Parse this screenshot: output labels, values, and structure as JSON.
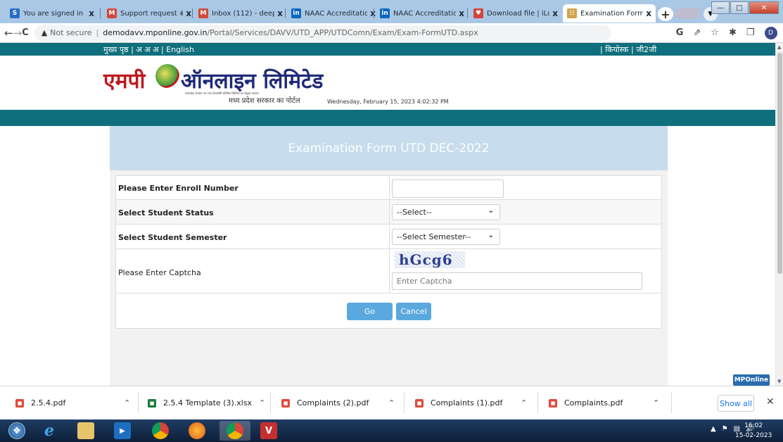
{
  "browser": {
    "tabs": [
      {
        "label": "You are signed in",
        "favicon": "S",
        "color": "#2a6dc4"
      },
      {
        "label": "Support request #",
        "favicon": "M",
        "color": "#d24a3a"
      },
      {
        "label": "Inbox (112) - deep",
        "favicon": "M",
        "color": "#d24a3a"
      },
      {
        "label": "NAAC Accreditatio",
        "favicon": "in",
        "color": "#0a66c2"
      },
      {
        "label": "NAAC Accreditatio",
        "favicon": "in",
        "color": "#0a66c2"
      },
      {
        "label": "Download file | iLo",
        "favicon": "♥",
        "color": "#d5423a"
      },
      {
        "label": "Examination Form",
        "favicon": "☷",
        "color": "#d2a24a"
      }
    ],
    "new_tab": "+",
    "tab_close": "x",
    "url": {
      "warning": "▲",
      "not_secure": "Not secure",
      "host": "demodavv.mponline.gov.in",
      "path": "/Portal/Services/DAVV/UTD_APP/UTDComn/Exam/Exam-FormUTD.aspx"
    },
    "nav": {
      "back": "←",
      "forward": "→",
      "reload": "C"
    },
    "toolbar_icons": {
      "google": "G",
      "share": "⇗",
      "star": "☆",
      "extensions": "✱",
      "sidepanel": "❒",
      "profile": "D",
      "menu": "⋮"
    }
  },
  "page": {
    "top_nav_left": "मुख्य पृष्ठ | अ  अ  अ  | English",
    "top_nav_right": "| कियोस्क | जी2जी",
    "logo": {
      "left": "एमपी",
      "right": "ऑनलाइन लिमिटेड",
      "tagline": "मध्यप्रदेश सरकार एवं टाटा कंसल्टेंसी सर्विसेस लिमिटेड का संयुक्त उपक्रम",
      "sub": "मध्य प्रदेश सरकार का पोर्टल"
    },
    "datetime": "Wednesday, February 15, 2023 4:02:32 PM",
    "form": {
      "title": "Examination Form UTD DEC-2022",
      "enroll_label": "Please Enter Enroll Number",
      "enroll_value": "",
      "status_label": "Select Student Status",
      "status_value": "--Select--",
      "semester_label": "Select Student Semester",
      "semester_value": "--Select Semester--",
      "captcha_label": "Please Enter Captcha",
      "captcha_text": "hGcg6",
      "captcha_placeholder": "Enter Captcha",
      "go_label": "Go",
      "cancel_label": "Cancel"
    },
    "badge": "MPOnline"
  },
  "downloads": {
    "items": [
      {
        "name": "2.5.4.pdf",
        "type": "pdf"
      },
      {
        "name": "2.5.4 Template (3).xlsx",
        "type": "xls"
      },
      {
        "name": "Complaints (2).pdf",
        "type": "pdf"
      },
      {
        "name": "Complaints (1).pdf",
        "type": "pdf"
      },
      {
        "name": "Complaints.pdf",
        "type": "pdf"
      }
    ],
    "show_all": "Show all",
    "close": "✕"
  },
  "taskbar": {
    "time": "16:02",
    "date": "15-02-2023"
  }
}
